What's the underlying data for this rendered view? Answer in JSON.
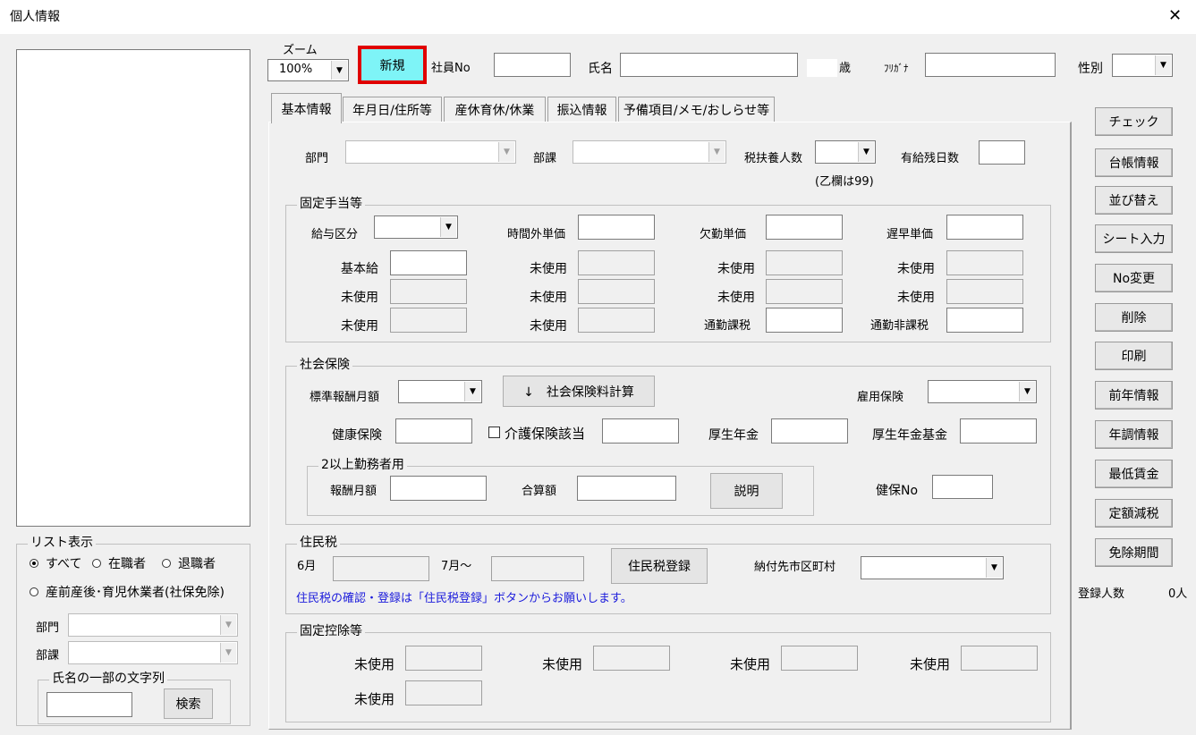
{
  "window": {
    "title": "個人情報",
    "close_glyph": "✕"
  },
  "header": {
    "zoom_label": "ズーム",
    "zoom_value": "100%",
    "new_button": "新規",
    "emp_no_label": "社員No",
    "name_label": "氏名",
    "age_label": "歳",
    "furigana_label": "ﾌﾘｶﾞﾅ",
    "gender_label": "性別"
  },
  "tabs": [
    {
      "label": "基本情報"
    },
    {
      "label": "年月日/住所等"
    },
    {
      "label": "産休育休/休業"
    },
    {
      "label": "振込情報"
    },
    {
      "label": "予備項目/メモ/おしらせ等"
    }
  ],
  "basic": {
    "dept_label": "部門",
    "section_label": "部課",
    "dependents_label": "税扶養人数",
    "dependents_note": "(乙欄は99)",
    "leave_label": "有給残日数"
  },
  "allowances": {
    "caption": "固定手当等",
    "pay_type_label": "給与区分",
    "overtime_label": "時間外単価",
    "absence_label": "欠勤単価",
    "late_label": "遅早単価",
    "base_pay_label": "基本給",
    "unused_label": "未使用",
    "commute_taxable_label": "通勤課税",
    "commute_nontaxable_label": "通勤非課税"
  },
  "social": {
    "caption": "社会保険",
    "std_monthly_label": "標準報酬月額",
    "calc_button": "↓　社会保険料計算",
    "employment_ins_label": "雇用保険",
    "health_ins_label": "健康保険",
    "care_ins_label": "介護保険該当",
    "pension_label": "厚生年金",
    "pension_fund_label": "厚生年金基金",
    "multi_caption": "2以上勤務者用",
    "remuneration_label": "報酬月額",
    "total_label": "合算額",
    "explain_button": "説明",
    "health_no_label": "健保No"
  },
  "resident_tax": {
    "caption": "住民税",
    "june_label": "6月",
    "july_label": "7月～",
    "register_button": "住民税登録",
    "city_label": "納付先市区町村",
    "note": "住民税の確認・登録は「住民税登録」ボタンからお願いします。"
  },
  "deductions": {
    "caption": "固定控除等",
    "unused_label": "未使用"
  },
  "side_buttons": [
    {
      "label": "チェック"
    },
    {
      "label": "台帳情報"
    },
    {
      "label": "並び替え"
    },
    {
      "label": "シート入力"
    },
    {
      "label": "No変更"
    },
    {
      "label": "削除"
    },
    {
      "label": "印刷"
    },
    {
      "label": "前年情報"
    },
    {
      "label": "年調情報"
    },
    {
      "label": "最低賃金"
    },
    {
      "label": "定額減税"
    },
    {
      "label": "免除期間"
    }
  ],
  "registered": {
    "label": "登録人数",
    "value": "0人"
  },
  "list_filter": {
    "caption": "リスト表示",
    "all": "すべて",
    "active": "在職者",
    "retired": "退職者",
    "leave": "産前産後･育児休業者(社保免除)",
    "dept_label": "部門",
    "section_label": "部課",
    "name_search_caption": "氏名の一部の文字列",
    "search_button": "検索"
  },
  "colors": {
    "new_button_bg": "#7ef4f7",
    "new_button_border": "#e00000",
    "note_text": "#1a1adb"
  }
}
